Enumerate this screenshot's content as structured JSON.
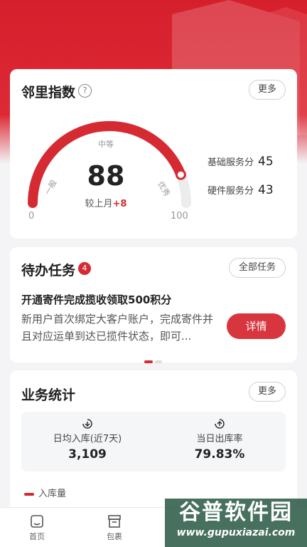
{
  "index_card": {
    "title": "邻里指数",
    "help_icon": "?",
    "more_label": "更多",
    "gauge": {
      "score": "88",
      "change_prefix": "较上月",
      "change_value": "+8",
      "level_top": "中等",
      "level_left": "一般",
      "level_right": "优秀",
      "min_label": "0",
      "max_label": "100",
      "fill_fraction": 0.88
    },
    "stats": [
      {
        "label": "基础服务分",
        "value": "45"
      },
      {
        "label": "硬件服务分",
        "value": "43"
      }
    ]
  },
  "tasks_card": {
    "title": "待办任务",
    "badge_count": "4",
    "all_label": "全部任务",
    "task_title": "开通寄件完成揽收领取500积分",
    "task_desc": "新用户首次绑定大客户账户，完成寄件并且对应运单到达已揽件状态，即可...",
    "detail_label": "详情"
  },
  "stats_card": {
    "title": "业务统计",
    "more_label": "更多",
    "items": [
      {
        "label": "日均入库(近7天)",
        "value": "3,109",
        "icon": "inbound-icon"
      },
      {
        "label": "当日出库率",
        "value": "79.83%",
        "icon": "outbound-icon"
      }
    ],
    "legend_label": "入库量"
  },
  "tabbar": {
    "tabs": [
      {
        "label": "首页",
        "icon": "home-icon"
      },
      {
        "label": "包裹",
        "icon": "package-icon"
      }
    ]
  },
  "watermark": {
    "main": "谷普软件园",
    "url": "www.gupuxiazai.com"
  },
  "colors": {
    "accent": "#d62a33",
    "hero": "#d61f2c",
    "background": "#f4f4f6"
  }
}
